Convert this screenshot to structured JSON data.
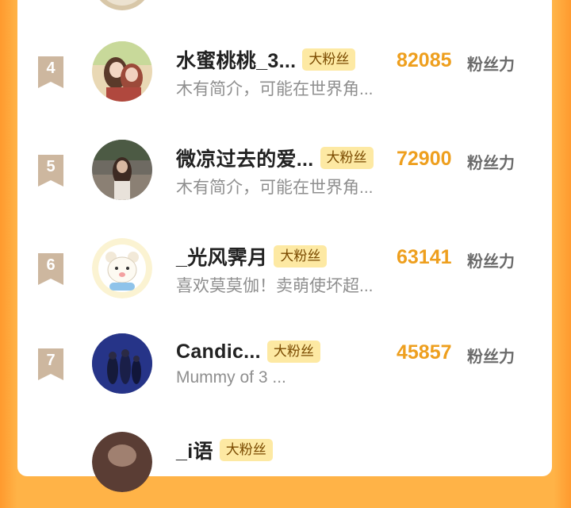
{
  "list": {
    "rows": [
      {
        "rank": "4",
        "name": "水蜜桃桃_3...",
        "badge": "大粉丝",
        "bio": "木有简介，可能在世界角...",
        "score": "82085",
        "unit": "粉丝力"
      },
      {
        "rank": "5",
        "name": "微凉过去的爱...",
        "badge": "大粉丝",
        "bio": "木有简介，可能在世界角...",
        "score": "72900",
        "unit": "粉丝力"
      },
      {
        "rank": "6",
        "name": "_光风霁月",
        "badge": "大粉丝",
        "bio": "喜欢莫莫伽！卖萌使坏超...",
        "score": "63141",
        "unit": "粉丝力"
      },
      {
        "rank": "7",
        "name": "Candic...",
        "badge": "大粉丝",
        "bio": "Mummy of 3 ...",
        "score": "45857",
        "unit": "粉丝力"
      },
      {
        "rank": "",
        "name": "_i语",
        "badge": "大粉丝",
        "bio": "",
        "score": "",
        "unit": ""
      }
    ]
  },
  "colors": {
    "frame": "#ffb347",
    "score": "#ee9f1e",
    "badge_bg": "#fde9a3",
    "rank_ribbon": "#cdb79f"
  }
}
